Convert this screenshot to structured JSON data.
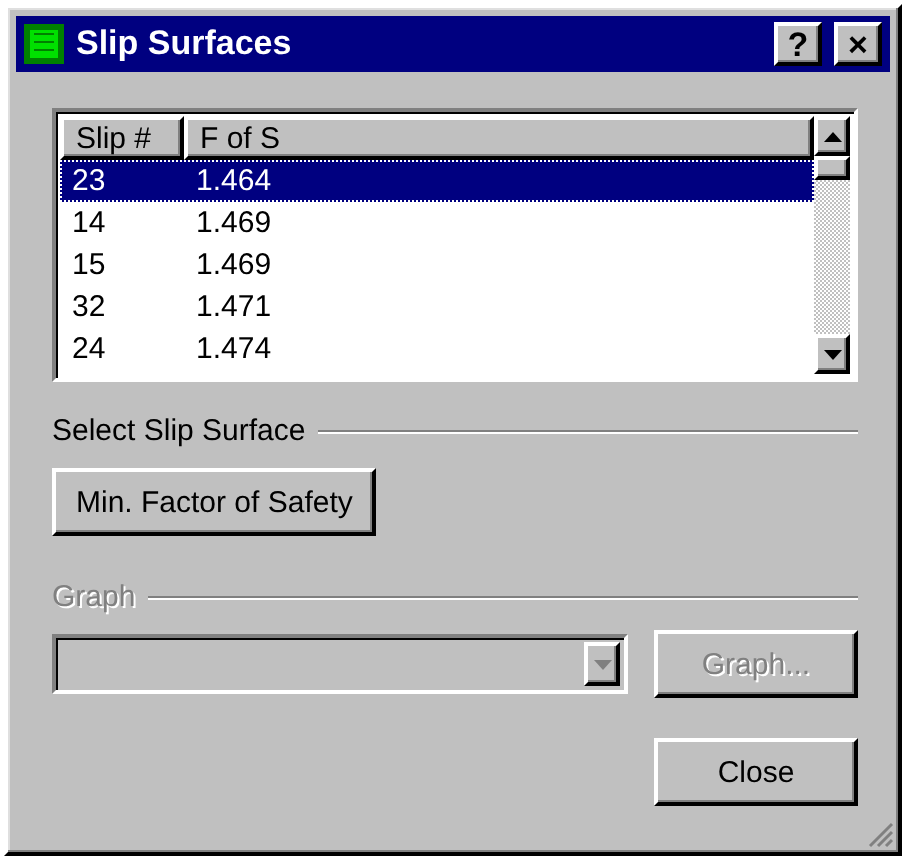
{
  "window": {
    "title": "Slip Surfaces",
    "title_buttons": [
      "?",
      "×"
    ]
  },
  "table": {
    "columns": [
      "Slip #",
      "F of S"
    ],
    "rows": [
      {
        "cells": [
          "23",
          "1.464"
        ],
        "selected": true
      },
      {
        "cells": [
          "14",
          "1.469"
        ],
        "selected": false
      },
      {
        "cells": [
          "15",
          "1.469"
        ],
        "selected": false
      },
      {
        "cells": [
          "32",
          "1.471"
        ],
        "selected": false
      },
      {
        "cells": [
          "24",
          "1.474"
        ],
        "selected": false
      }
    ]
  },
  "select_group": {
    "label": "Select Slip Surface",
    "disabled": false,
    "button": {
      "label": "Min. Factor of Safety",
      "disabled": false
    }
  },
  "graph_group": {
    "label": "Graph",
    "disabled": true,
    "combo": {
      "disabled": true
    },
    "button": {
      "label": "Graph...",
      "disabled": true
    }
  },
  "close_button": {
    "label": "Close",
    "disabled": false
  }
}
